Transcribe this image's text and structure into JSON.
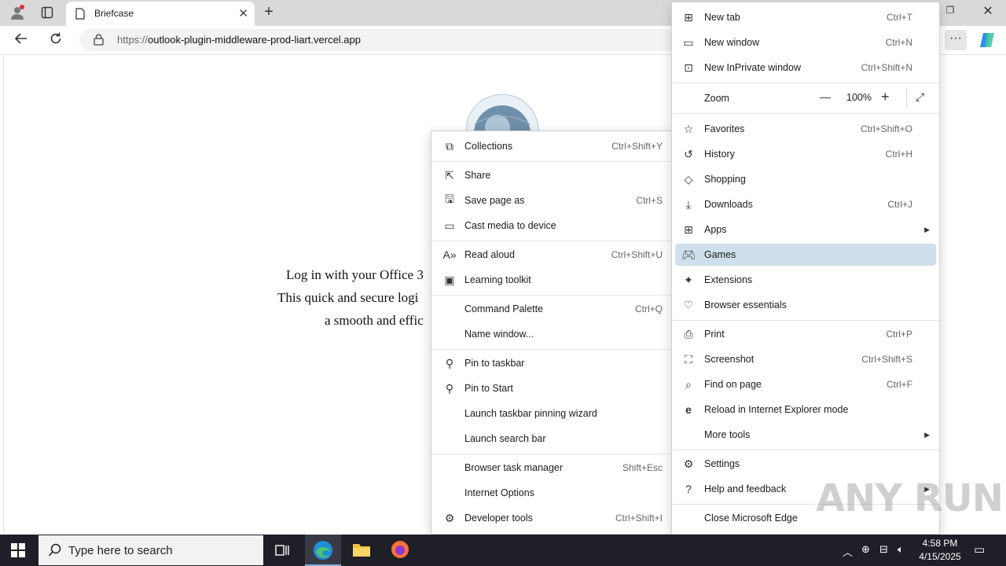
{
  "browser": {
    "tab_title": "Briefcase",
    "url_scheme": "https://",
    "url_host": "outlook-plugin-middleware-prod-liart.vercel.app"
  },
  "page": {
    "line1": "Log in with your Office 3",
    "line2": "This quick and secure logi",
    "line3": "a smooth and effic"
  },
  "main_menu": {
    "items": [
      {
        "label": "New tab",
        "shortcut": "Ctrl+T",
        "icon": "new-tab-icon"
      },
      {
        "label": "New window",
        "shortcut": "Ctrl+N",
        "icon": "new-window-icon"
      },
      {
        "label": "New InPrivate window",
        "shortcut": "Ctrl+Shift+N",
        "icon": "inprivate-icon"
      },
      {
        "label": "Favorites",
        "shortcut": "Ctrl+Shift+O",
        "icon": "star-icon"
      },
      {
        "label": "History",
        "shortcut": "Ctrl+H",
        "icon": "history-icon"
      },
      {
        "label": "Shopping",
        "shortcut": "",
        "icon": "tag-icon"
      },
      {
        "label": "Downloads",
        "shortcut": "Ctrl+J",
        "icon": "download-icon"
      },
      {
        "label": "Apps",
        "shortcut": "",
        "icon": "apps-icon"
      },
      {
        "label": "Games",
        "shortcut": "",
        "icon": "gamepad-icon"
      },
      {
        "label": "Extensions",
        "shortcut": "",
        "icon": "puzzle-icon"
      },
      {
        "label": "Browser essentials",
        "shortcut": "",
        "icon": "heart-pulse-icon"
      },
      {
        "label": "Print",
        "shortcut": "Ctrl+P",
        "icon": "printer-icon"
      },
      {
        "label": "Screenshot",
        "shortcut": "Ctrl+Shift+S",
        "icon": "screenshot-icon"
      },
      {
        "label": "Find on page",
        "shortcut": "Ctrl+F",
        "icon": "find-icon"
      },
      {
        "label": "Reload in Internet Explorer mode",
        "shortcut": "",
        "icon": "ie-icon"
      },
      {
        "label": "More tools",
        "shortcut": "",
        "icon": ""
      },
      {
        "label": "Settings",
        "shortcut": "",
        "icon": "gear-icon"
      },
      {
        "label": "Help and feedback",
        "shortcut": "",
        "icon": "help-icon"
      },
      {
        "label": "Close Microsoft Edge",
        "shortcut": "",
        "icon": ""
      }
    ],
    "zoom_label": "Zoom",
    "zoom_value": "100%",
    "zoom_minus": "—",
    "zoom_plus": "+"
  },
  "sub_menu": {
    "items": [
      {
        "label": "Collections",
        "shortcut": "Ctrl+Shift+Y",
        "icon": "collections-icon"
      },
      {
        "label": "Share",
        "shortcut": "",
        "icon": "share-icon"
      },
      {
        "label": "Save page as",
        "shortcut": "Ctrl+S",
        "icon": "save-icon"
      },
      {
        "label": "Cast media to device",
        "shortcut": "",
        "icon": "cast-icon"
      },
      {
        "label": "Read aloud",
        "shortcut": "Ctrl+Shift+U",
        "icon": "read-aloud-icon"
      },
      {
        "label": "Learning toolkit",
        "shortcut": "",
        "icon": "learning-icon"
      },
      {
        "label": "Command Palette",
        "shortcut": "Ctrl+Q",
        "icon": ""
      },
      {
        "label": "Name window...",
        "shortcut": "",
        "icon": ""
      },
      {
        "label": "Pin to taskbar",
        "shortcut": "",
        "icon": "pin-icon"
      },
      {
        "label": "Pin to Start",
        "shortcut": "",
        "icon": "pin-icon"
      },
      {
        "label": "Launch taskbar pinning wizard",
        "shortcut": "",
        "icon": ""
      },
      {
        "label": "Launch search bar",
        "shortcut": "",
        "icon": ""
      },
      {
        "label": "Browser task manager",
        "shortcut": "Shift+Esc",
        "icon": ""
      },
      {
        "label": "Internet Options",
        "shortcut": "",
        "icon": ""
      },
      {
        "label": "Developer tools",
        "shortcut": "Ctrl+Shift+I",
        "icon": "devtools-icon"
      }
    ]
  },
  "taskbar": {
    "search_placeholder": "Type here to search",
    "time": "4:58 PM",
    "date": "4/15/2025"
  },
  "watermark": "ANY RUN"
}
